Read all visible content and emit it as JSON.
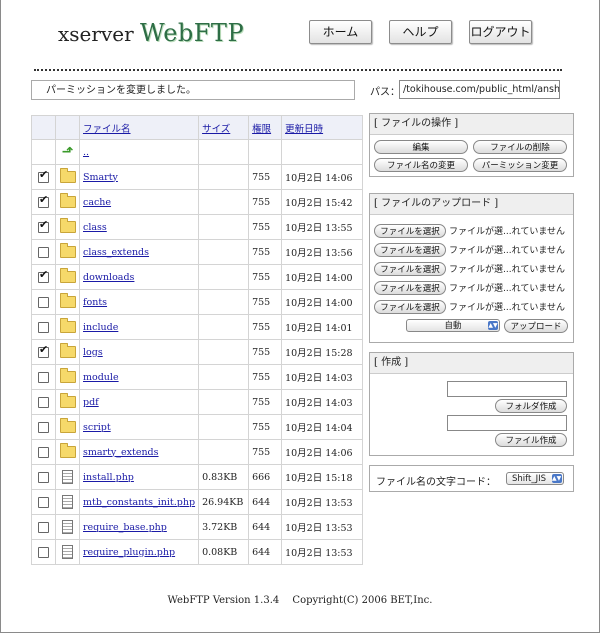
{
  "header": {
    "logo_small": "xserver",
    "logo_big": "WebFTP",
    "home": "ホーム",
    "help": "ヘルプ",
    "logout": "ログアウト"
  },
  "message": "パーミッションを変更しました。",
  "path": {
    "label": "パス：",
    "value": "/tokihouse.com/public_html/anshop"
  },
  "table": {
    "headers": {
      "name": "ファイル名",
      "size": "サイズ",
      "perm": "権限",
      "date": "更新日時"
    },
    "parent_link": "..",
    "rows": [
      {
        "checked": true,
        "type": "folder",
        "name": "Smarty",
        "size": "",
        "perm": "755",
        "date": "10月2日 14:06"
      },
      {
        "checked": true,
        "type": "folder",
        "name": "cache",
        "size": "",
        "perm": "755",
        "date": "10月2日 15:42"
      },
      {
        "checked": true,
        "type": "folder",
        "name": "class",
        "size": "",
        "perm": "755",
        "date": "10月2日 13:55"
      },
      {
        "checked": false,
        "type": "folder",
        "name": "class_extends",
        "size": "",
        "perm": "755",
        "date": "10月2日 13:56"
      },
      {
        "checked": true,
        "type": "folder",
        "name": "downloads",
        "size": "",
        "perm": "755",
        "date": "10月2日 14:00"
      },
      {
        "checked": false,
        "type": "folder",
        "name": "fonts",
        "size": "",
        "perm": "755",
        "date": "10月2日 14:00"
      },
      {
        "checked": false,
        "type": "folder",
        "name": "include",
        "size": "",
        "perm": "755",
        "date": "10月2日 14:01"
      },
      {
        "checked": true,
        "type": "folder",
        "name": "logs",
        "size": "",
        "perm": "755",
        "date": "10月2日 15:28"
      },
      {
        "checked": false,
        "type": "folder",
        "name": "module",
        "size": "",
        "perm": "755",
        "date": "10月2日 14:03"
      },
      {
        "checked": false,
        "type": "folder",
        "name": "pdf",
        "size": "",
        "perm": "755",
        "date": "10月2日 14:03"
      },
      {
        "checked": false,
        "type": "folder",
        "name": "script",
        "size": "",
        "perm": "755",
        "date": "10月2日 14:04"
      },
      {
        "checked": false,
        "type": "folder",
        "name": "smarty_extends",
        "size": "",
        "perm": "755",
        "date": "10月2日 14:06"
      },
      {
        "checked": false,
        "type": "file",
        "name": "install.php",
        "size": "0.83KB",
        "perm": "666",
        "date": "10月2日 15:18"
      },
      {
        "checked": false,
        "type": "file",
        "name": "mtb_constants_init.php",
        "size": "26.94KB",
        "perm": "644",
        "date": "10月2日 13:53"
      },
      {
        "checked": false,
        "type": "file",
        "name": "require_base.php",
        "size": "3.72KB",
        "perm": "644",
        "date": "10月2日 13:53"
      },
      {
        "checked": false,
        "type": "file",
        "name": "require_plugin.php",
        "size": "0.08KB",
        "perm": "644",
        "date": "10月2日 13:53"
      }
    ]
  },
  "ops": {
    "title": "[ ファイルの操作 ]",
    "edit": "編集",
    "delete": "ファイルの削除",
    "rename": "ファイル名の変更",
    "chmod": "パーミッション変更"
  },
  "upload": {
    "title": "[ ファイルのアップロード ]",
    "choose": "ファイルを選択",
    "no_file": "ファイルが選...れていません",
    "mode": "自動",
    "submit": "アップロード"
  },
  "create": {
    "title": "[ 作成 ]",
    "folder_btn": "フォルダ作成",
    "file_btn": "ファイル作成"
  },
  "charset": {
    "label": "ファイル名の文字コード：",
    "value": "Shift_JIS"
  },
  "footer": "WebFTP Version 1.3.4　 Copyright(C) 2006 BET,Inc."
}
